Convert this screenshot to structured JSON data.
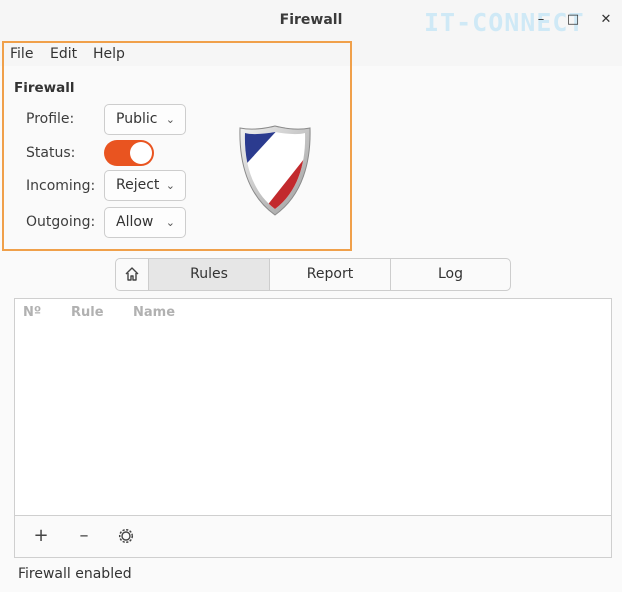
{
  "window": {
    "title": "Firewall",
    "watermark": "IT-CONNECT"
  },
  "controls": {
    "minimize": "–",
    "maximize": "□",
    "close": "✕"
  },
  "menu": {
    "file": "File",
    "edit": "Edit",
    "help": "Help"
  },
  "firewall_section": {
    "heading": "Firewall",
    "profile_label": "Profile:",
    "profile_value": "Public",
    "status_label": "Status:",
    "status_on": true,
    "incoming_label": "Incoming:",
    "incoming_value": "Reject",
    "outgoing_label": "Outgoing:",
    "outgoing_value": "Allow"
  },
  "tabs": {
    "rules": "Rules",
    "report": "Report",
    "log": "Log",
    "active": "rules"
  },
  "table": {
    "columns": [
      "Nº",
      "Rule",
      "Name"
    ]
  },
  "toolbar": {
    "add": "+",
    "remove": "–"
  },
  "status_text": "Firewall enabled",
  "colors": {
    "accent": "#e95420",
    "highlight_border": "#f0a04a"
  }
}
